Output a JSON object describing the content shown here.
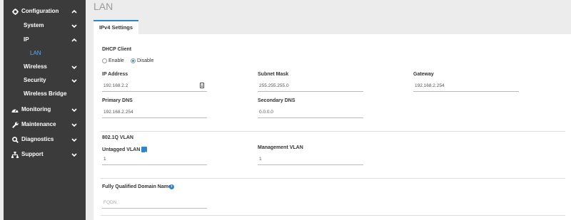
{
  "sidebar": {
    "configuration": "Configuration",
    "system": "System",
    "ip": "IP",
    "lan": "LAN",
    "wireless": "Wireless",
    "security": "Security",
    "wireless_bridge": "Wireless Bridge",
    "monitoring": "Monitoring",
    "maintenance": "Maintenance",
    "diagnostics": "Diagnostics",
    "support": "Support"
  },
  "page": {
    "title": "LAN",
    "tab": "IPv4 Settings"
  },
  "dhcp": {
    "label": "DHCP Client",
    "enable": "Enable",
    "disable": "Disable",
    "selected": "Disable"
  },
  "fields": {
    "ip_address": {
      "label": "IP Address",
      "value": "192.168.2.2"
    },
    "subnet_mask": {
      "label": "Subnet Mask",
      "value": "255.255.255.0"
    },
    "gateway": {
      "label": "Gateway",
      "value": "192.168.2.254"
    },
    "primary_dns": {
      "label": "Primary DNS",
      "value": "192.168.2.254"
    },
    "secondary_dns": {
      "label": "Secondary DNS",
      "value": "0.0.0.0"
    }
  },
  "vlan": {
    "section_label": "802.1Q VLAN",
    "untagged_label": "Untagged VLAN",
    "untagged_checked": true,
    "untagged_value": "1",
    "management_label": "Management VLAN",
    "management_value": "1"
  },
  "fqdn": {
    "label": "Fully Qualified Domain Name",
    "placeholder": "FQDN"
  },
  "colors": {
    "sidebar_bg": "#3b3b3b",
    "accent": "#2e86c9",
    "page_bg": "#ececec"
  },
  "icons": [
    "gear-icon",
    "chevron-up-icon",
    "chevron-down-icon",
    "dashboard-icon",
    "wrench-icon",
    "search-icon",
    "sitemap-icon",
    "info-icon",
    "key-icon"
  ]
}
